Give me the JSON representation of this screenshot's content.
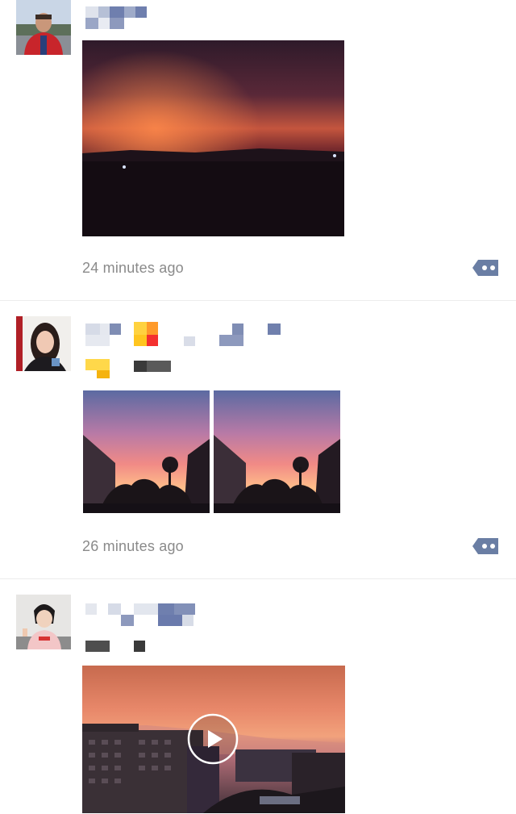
{
  "feed": {
    "posts": [
      {
        "timestamp": "24 minutes ago",
        "avatar": "avatar-man-red-jacket",
        "media": [
          "sunset-photo-dark-horizon"
        ],
        "comment_icon": "comment-dots-icon"
      },
      {
        "timestamp": "26 minutes ago",
        "avatar": "avatar-woman-selfie",
        "media": [
          "sunset-building-photo-1",
          "sunset-building-photo-2"
        ],
        "comment_icon": "comment-dots-icon"
      },
      {
        "avatar": "avatar-girl-pink-shirt",
        "media": [
          "sunset-video-thumbnail"
        ],
        "play_icon": "play-icon"
      }
    ]
  },
  "colors": {
    "accent": "#576b95",
    "timestamp": "#8a8a8a",
    "divider": "#ececec"
  }
}
